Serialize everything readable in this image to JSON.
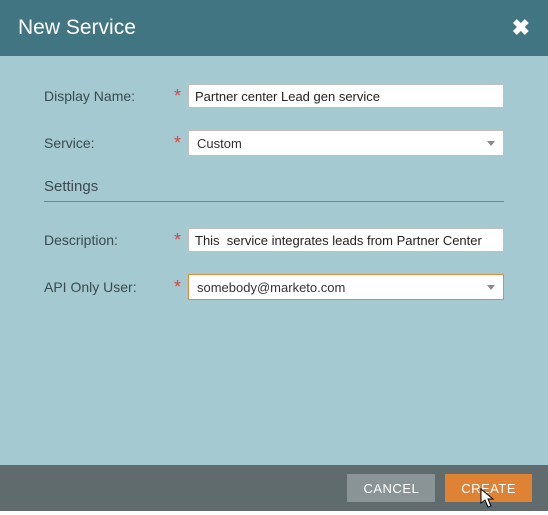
{
  "dialog": {
    "title": "New Service",
    "close_label": "Close"
  },
  "form": {
    "display_name": {
      "label": "Display Name:",
      "value": "Partner center Lead gen service"
    },
    "service": {
      "label": "Service:",
      "value": "Custom"
    },
    "description": {
      "label": "Description:",
      "value": "This  service integrates leads from Partner Center"
    },
    "api_user": {
      "label": "API Only User:",
      "value": "somebody@marketo.com"
    }
  },
  "section": {
    "settings": "Settings"
  },
  "footer": {
    "cancel": "CANCEL",
    "create": "CREATE"
  }
}
